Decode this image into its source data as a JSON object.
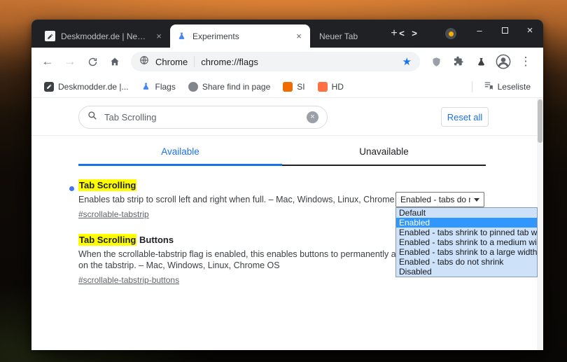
{
  "icons": {
    "back": "←",
    "forward": "→",
    "plus": "+",
    "chevron_left": "<",
    "chevron_right": ">",
    "minimize": "–",
    "close_window": "×",
    "tab_close": "×",
    "star": "★",
    "menu": "⋮",
    "clear": "×",
    "omnibox_separator": "|"
  },
  "titlebar": {
    "tabs": [
      {
        "label": "Deskmodder.de | News, Tipps"
      },
      {
        "label": "Experiments"
      },
      {
        "label": "Neuer Tab"
      }
    ]
  },
  "toolbar": {
    "site_label": "Chrome",
    "url": "chrome://flags"
  },
  "bookmarks": {
    "items": [
      {
        "label": "Deskmodder.de |..."
      },
      {
        "label": "Flags"
      },
      {
        "label": "Share find in page"
      },
      {
        "label": "SI"
      },
      {
        "label": "HD"
      }
    ],
    "reading_list": "Leseliste"
  },
  "page": {
    "search_value": "Tab Scrolling",
    "reset_button": "Reset all",
    "tab_available": "Available",
    "tab_unavailable": "Unavailable",
    "flags": [
      {
        "title_highlight": "Tab Scrolling",
        "title_rest": "",
        "description": "Enables tab strip to scroll left and right when full. – Mac, Windows, Linux, Chrome OS",
        "link": "#scrollable-tabstrip",
        "select_value": "Enabled - tabs do not"
      },
      {
        "title_highlight": "Tab Scrolling",
        "title_rest": " Buttons",
        "description": "When the scrollable-tabstrip flag is enabled, this enables buttons to permanently appear on the tabstrip. – Mac, Windows, Linux, Chrome OS",
        "link": "#scrollable-tabstrip-buttons"
      }
    ],
    "dropdown": {
      "options": [
        "Default",
        "Enabled",
        "Enabled - tabs shrink to pinned tab width",
        "Enabled - tabs shrink to a medium width",
        "Enabled - tabs shrink to a large width",
        "Enabled - tabs do not shrink",
        "Disabled"
      ],
      "selected_index": 1
    }
  },
  "colors": {
    "accent": "#1a73e8",
    "highlight": "#ffff00",
    "option_selected_bg": "#3297fd"
  }
}
